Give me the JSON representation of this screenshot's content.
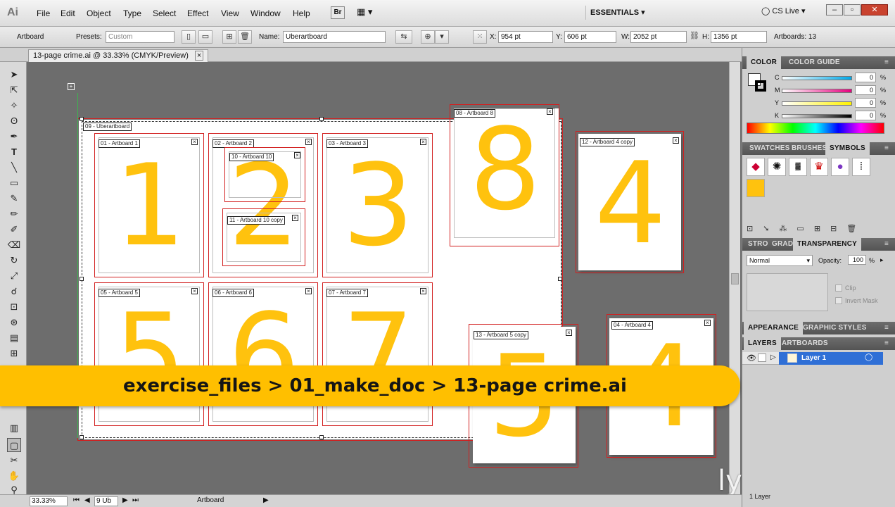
{
  "app": {
    "logo": "Ai",
    "workspace": "ESSENTIALS",
    "cslive": "CS Live",
    "bridge": "Br"
  },
  "menu": [
    "File",
    "Edit",
    "Object",
    "Type",
    "Select",
    "Effect",
    "View",
    "Window",
    "Help"
  ],
  "control": {
    "tool_label": "Artboard",
    "presets_label": "Presets:",
    "presets_value": "Custom",
    "name_label": "Name:",
    "name_value": "Uberartboard",
    "x_label": "X:",
    "x_value": "954 pt",
    "y_label": "Y:",
    "y_value": "606 pt",
    "w_label": "W:",
    "w_value": "2052 pt",
    "h_label": "H:",
    "h_value": "1356 pt",
    "artboards_label": "Artboards: 13"
  },
  "document": {
    "tab_title": "13-page crime.ai @ 33.33% (CMYK/Preview)",
    "close": "×"
  },
  "artboards": [
    {
      "label": "01 - Artboard 1",
      "digit": "1"
    },
    {
      "label": "02 - Artboard 2",
      "digit": "2"
    },
    {
      "label": "03 - Artboard 3",
      "digit": "3"
    },
    {
      "label": "08 - Artboard 8",
      "digit": "8"
    },
    {
      "label": "12 - Artboard 4 copy",
      "digit": "4"
    },
    {
      "label": "05 - Artboard 5",
      "digit": "5"
    },
    {
      "label": "06 - Artboard 6",
      "digit": "6"
    },
    {
      "label": "07 - Artboard 7",
      "digit": "7"
    },
    {
      "label": "13 - Artboard 5 copy",
      "digit": "5"
    },
    {
      "label": "04 - Artboard 4",
      "digit": "4"
    },
    {
      "label": "10 - Artboard 10",
      "digit": ""
    },
    {
      "label": "11 - Artboard 10 copy",
      "digit": ""
    },
    {
      "label": "09 - Uberartboard",
      "digit": ""
    }
  ],
  "banner": {
    "path": "exercise_files > 01_make_doc > 13-page crime.ai"
  },
  "watermark": "lynda.com",
  "status": {
    "zoom": "33.33%",
    "page": "9 Ub",
    "tool": "Artboard"
  },
  "color_panel": {
    "tabs": [
      "COLOR",
      "COLOR GUIDE"
    ],
    "channels": [
      {
        "name": "C",
        "value": "0"
      },
      {
        "name": "M",
        "value": "0"
      },
      {
        "name": "Y",
        "value": "0"
      },
      {
        "name": "K",
        "value": "0"
      }
    ],
    "unit": "%"
  },
  "swatch_panel": {
    "tabs": [
      "SWATCHES",
      "BRUSHES",
      "SYMBOLS"
    ]
  },
  "transparency_panel": {
    "tabs": [
      "STRO",
      "GRAD",
      "TRANSPARENCY"
    ],
    "mode": "Normal",
    "opacity_label": "Opacity:",
    "opacity_value": "100",
    "unit": "%",
    "clip": "Clip",
    "invert": "Invert Mask"
  },
  "appearance_panel": {
    "tabs": [
      "APPEARANCE",
      "GRAPHIC STYLES"
    ]
  },
  "layers_panel": {
    "tabs": [
      "LAYERS",
      "ARTBOARDS"
    ],
    "layer_name": "Layer 1",
    "count": "1 Layer"
  },
  "colors": {
    "accent_yellow": "#ffc20e",
    "artboard_red": "#d21f1f",
    "layer_blue": "#2f6fd6"
  }
}
